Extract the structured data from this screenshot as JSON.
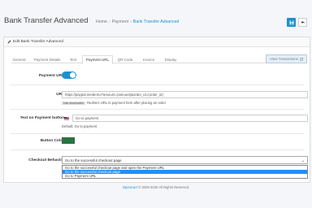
{
  "header": {
    "title": "Bank Transfer Advanced",
    "breadcrumb": [
      "Home",
      "Payment",
      "Bank Transfer Advanced"
    ],
    "breadcrumb_sep": "›"
  },
  "card": {
    "heading": "Edit Bank Transfer Advanced",
    "tabs": [
      "General",
      "Payment Details",
      "Text",
      "Payment URL",
      "QR Code",
      "Invoice",
      "Display"
    ],
    "active_tab": "Payment URL",
    "view_button": "View Transactions"
  },
  "form": {
    "payment_url": {
      "label": "Payment URL",
      "enabled": true
    },
    "url": {
      "label": "URL",
      "value": "https://paypal.me/demo?amount={amount}&order_id={order_id}",
      "help_tag": "Use shortcodes",
      "help_text": "Redirect URL to payment form after placing an order"
    },
    "button_text": {
      "label": "Text on Payment button",
      "value": "Go to payment",
      "default_text": "Default: Go to payment"
    },
    "button_color": {
      "label": "Button Color",
      "color": "#1e7a3c"
    },
    "checkout_behavior": {
      "label": "Checkout Behavior",
      "value": "Go to the successful checkout page",
      "options": [
        "Go to the successful checkout page and open the Payment URL",
        "Go to the successful checkout page",
        "Go to Payment URL"
      ],
      "selected_index": 1
    }
  },
  "footer": {
    "brand": "OpenCart",
    "text": "© 2009-2025 All Rights Reserved."
  },
  "colors": {
    "accent": "#1e91cf",
    "select_highlight": "#1e90ff"
  }
}
